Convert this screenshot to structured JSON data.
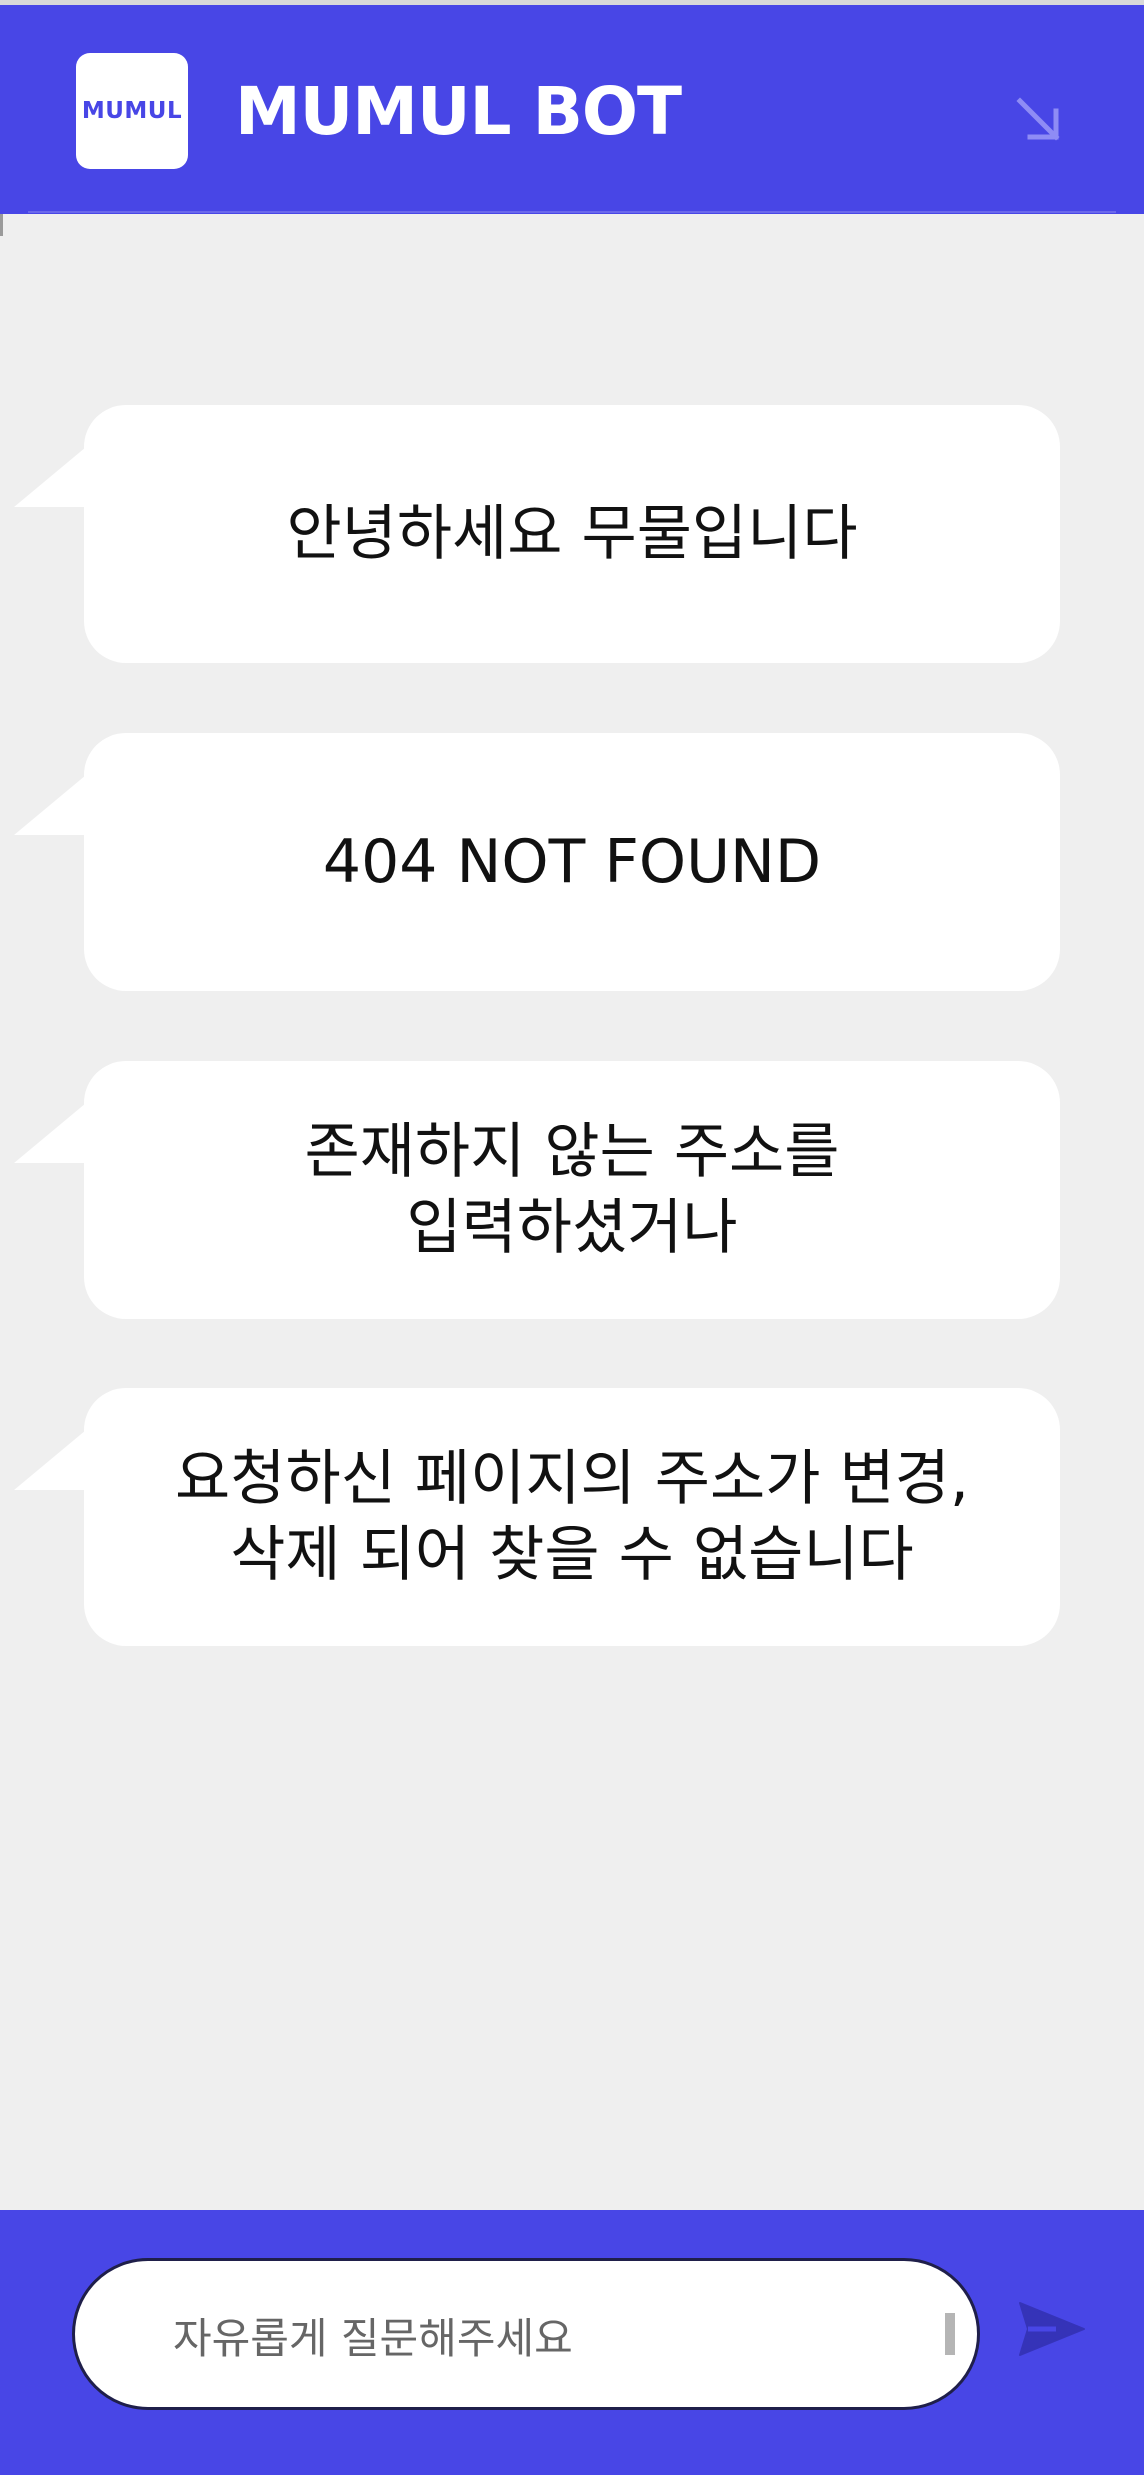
{
  "header": {
    "logo_text": "MUMUL",
    "title": "MUMUL BOT",
    "minimize_icon": "arrow-down-right-icon"
  },
  "messages": [
    {
      "text": "안녕하세요 무물입니다"
    },
    {
      "text": "404 NOT FOUND"
    },
    {
      "text": "존재하지 않는 주소를\n입력하셨거나"
    },
    {
      "text": "요청하신 페이지의 주소가 변경,\n삭제 되어 찾을 수 없습니다"
    }
  ],
  "composer": {
    "placeholder": "자유롭게 질문해주세요",
    "send_icon": "send-icon"
  },
  "colors": {
    "brand": "#4846e6",
    "chat_background": "#efefef",
    "bubble": "#ffffff",
    "text": "#111111"
  }
}
